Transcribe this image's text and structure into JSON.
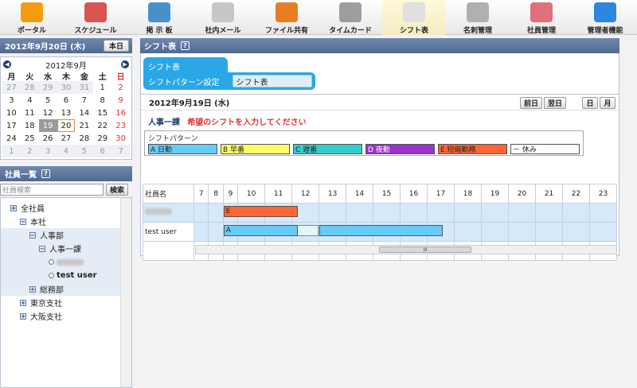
{
  "nav": [
    {
      "label": "ポータル",
      "icon": "home-icon",
      "color": "#f39c12"
    },
    {
      "label": "スケジュール",
      "icon": "calendar-icon",
      "color": "#d9534f"
    },
    {
      "label": "掲 示 板",
      "icon": "bulletin-board-icon",
      "color": "#4a90c8"
    },
    {
      "label": "社内メール",
      "icon": "mail-icon",
      "color": "#c7c7c7"
    },
    {
      "label": "ファイル共有",
      "icon": "folder-icon",
      "color": "#e67e22"
    },
    {
      "label": "タイムカード",
      "icon": "clock-icon",
      "color": "#9e9e9e"
    },
    {
      "label": "シフト表",
      "icon": "shift-pencil-icon",
      "color": "#e0e0e0"
    },
    {
      "label": "名刺管理",
      "icon": "business-card-icon",
      "color": "#b0b0b0"
    },
    {
      "label": "社員管理",
      "icon": "users-icon",
      "color": "#e0707a"
    },
    {
      "label": "管理者機能",
      "icon": "admin-monitor-icon",
      "color": "#2e86de"
    }
  ],
  "nav_active_index": 6,
  "calendar": {
    "header": "2012年9月20日 (木)",
    "today_button": "本日",
    "month_title": "2012年9月",
    "dow": [
      "月",
      "火",
      "水",
      "木",
      "金",
      "土",
      "日"
    ],
    "weeks": [
      [
        "27",
        "28",
        "29",
        "30",
        "31",
        "1",
        "2"
      ],
      [
        "3",
        "4",
        "5",
        "6",
        "7",
        "8",
        "9"
      ],
      [
        "10",
        "11",
        "12",
        "13",
        "14",
        "15",
        "16"
      ],
      [
        "17",
        "18",
        "19",
        "20",
        "21",
        "22",
        "23"
      ],
      [
        "24",
        "25",
        "26",
        "27",
        "28",
        "29",
        "30"
      ],
      [
        "1",
        "2",
        "3",
        "4",
        "5",
        "6",
        "7"
      ]
    ]
  },
  "employees": {
    "header": "社員一覧",
    "search_placeholder": "社員検索",
    "search_button": "検索",
    "tree": [
      {
        "label": "全社員",
        "level": 0,
        "type": "plus"
      },
      {
        "label": "本社",
        "level": 1,
        "type": "minus"
      },
      {
        "label": "人事部",
        "level": 2,
        "type": "minus"
      },
      {
        "label": "人事一課",
        "level": 3,
        "type": "minus"
      },
      {
        "label": "",
        "level": 4,
        "type": "dot",
        "blurred": true
      },
      {
        "label": "test user",
        "level": 4,
        "type": "dot",
        "bold": true
      },
      {
        "label": "総務部",
        "level": 2,
        "type": "plus"
      },
      {
        "label": "東京支社",
        "level": 1,
        "type": "plus"
      },
      {
        "label": "大阪支社",
        "level": 1,
        "type": "plus"
      }
    ]
  },
  "shift": {
    "header": "シフト表",
    "tab_top": "シフト表",
    "tab_setting": "シフトパターン設定",
    "tab_selected": "シフト表",
    "date": "2012年9月19日 (水)",
    "prev": "前日",
    "next": "翌日",
    "day": "日",
    "month": "月",
    "dept": "人事一課",
    "message": "希望のシフトを入力してください",
    "pattern_label": "シフトパターン",
    "patterns": [
      {
        "label": "A 日勤",
        "color": "#66ccf5"
      },
      {
        "label": "B 早番",
        "color": "#ffff66"
      },
      {
        "label": "C 遅番",
        "color": "#33cccc"
      },
      {
        "label": "D 夜勤",
        "color": "#9933cc"
      },
      {
        "label": "E 短縮勤務",
        "color": "#ff6633"
      },
      {
        "label": "－ 休み",
        "color": "#ffffff"
      }
    ],
    "col_header": "社員名",
    "hours": [
      "7",
      "8",
      "9",
      "10",
      "11",
      "12",
      "13",
      "14",
      "15",
      "16",
      "17",
      "18",
      "19",
      "20",
      "21",
      "22",
      "23"
    ],
    "rows": [
      {
        "name": "",
        "blurred": true,
        "bar_label": "E",
        "bar_color": "#ff6633"
      },
      {
        "name": "test user",
        "blurred": false,
        "bar_label": "A",
        "bar_color": "#66ccf5"
      }
    ],
    "scroll_mark": "III"
  }
}
